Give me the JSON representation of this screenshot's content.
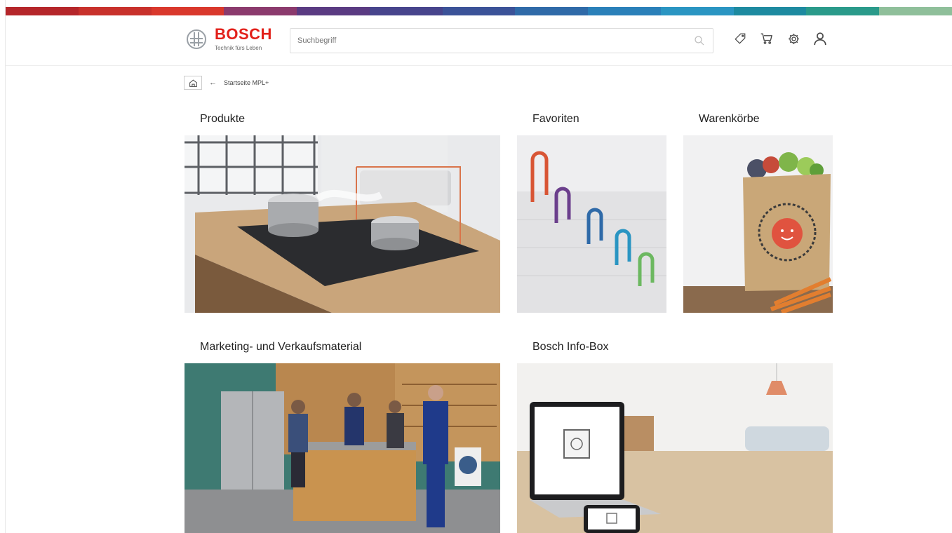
{
  "topbar_colors": [
    "#b5262a",
    "#c8312b",
    "#d9382c",
    "#8b3a6d",
    "#5a3b82",
    "#47448c",
    "#3b5298",
    "#2f6aa8",
    "#2a80b9",
    "#2a95c2",
    "#1d8aa0",
    "#2a9a8a",
    "#8fbf9a"
  ],
  "brand": {
    "name": "BOSCH",
    "tagline": "Technik fürs Leben",
    "color": "#e2201a"
  },
  "search": {
    "placeholder": "Suchbegriff"
  },
  "header_icons": [
    "tag-icon",
    "cart-icon",
    "settings-icon",
    "user-icon"
  ],
  "breadcrumb": {
    "current": "Startseite MPL+"
  },
  "tiles": [
    {
      "id": "produkte",
      "title": "Produkte"
    },
    {
      "id": "favoriten",
      "title": "Favoriten"
    },
    {
      "id": "warenkoerbe",
      "title": "Warenkörbe"
    },
    {
      "id": "marketing",
      "title": "Marketing- und Verkaufsmaterial"
    },
    {
      "id": "infobox",
      "title": "Bosch Info-Box"
    }
  ]
}
